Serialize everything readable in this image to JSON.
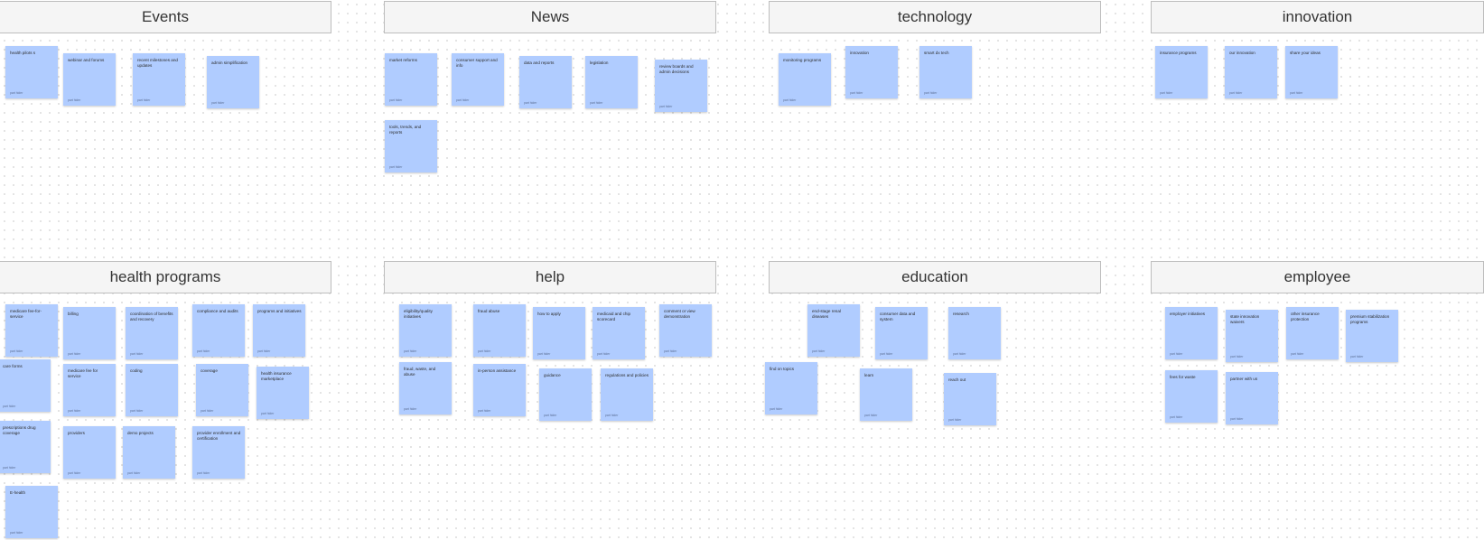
{
  "headers": [
    "Events",
    "News",
    "technology",
    "innovation",
    "health programs",
    "help",
    "education",
    "employee"
  ],
  "author": "part hider",
  "notes": [
    "health pilots s",
    "webinar and forums",
    "recent milestones and updates",
    "admin simplification",
    "market reforms",
    "consumer support and info",
    "data and reports",
    "legislation",
    "review boards and admin decisions",
    "tools, trends, and reports",
    "monitoring programs",
    "innovation",
    "smart dx tech",
    "insurance programs",
    "our innovation",
    "share your ideas",
    "medicare fee-for-service",
    "billing",
    "coordination of benefits and recovery",
    "compliance and audits",
    "programs and initiatives",
    "care forms",
    "medicare fee for service",
    "coding",
    "coverage",
    "health insurance marketplace",
    "prescriptions drug coverage",
    "providers",
    "demo projects",
    "provider enrollment and certification",
    "E-health",
    "eligibility/quality initiatives",
    "fraud abuse",
    "how to apply",
    "medicaid and chip scorecard",
    "comment or view demonstration",
    "fraud, waste, and abuse",
    "in-person assistance",
    "guidance",
    "regulations and policies",
    "end-stage renal diseases",
    "consumer data and system",
    "research",
    "find on topics",
    "learn",
    "reach out",
    "employer initiatives",
    "state innovation waivers",
    "other insurance protection",
    "premium stabilization programs",
    "fees for waste",
    "partner with us"
  ]
}
